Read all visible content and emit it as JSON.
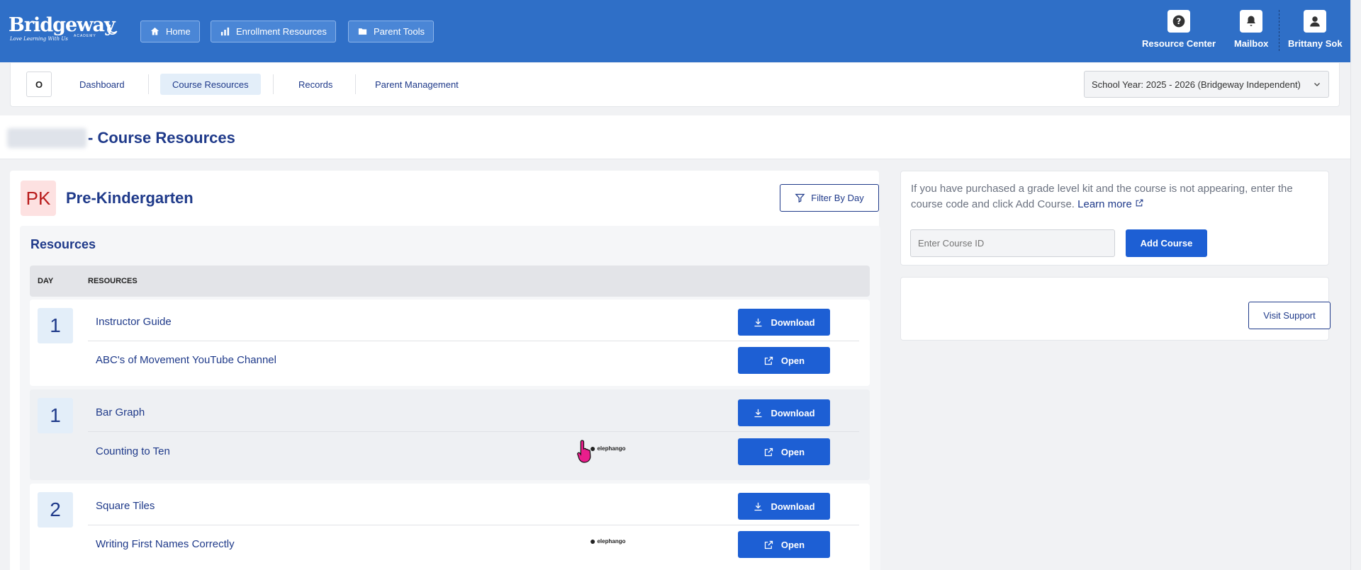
{
  "header": {
    "logo_text": "Bridgeway",
    "logo_sub": "Love Learning With Us",
    "logo_academy": "ACADEMY",
    "nav": [
      {
        "label": "Home",
        "icon": "home-icon"
      },
      {
        "label": "Enrollment Resources",
        "icon": "bar-chart-icon"
      },
      {
        "label": "Parent Tools",
        "icon": "folder-icon"
      }
    ],
    "resource_center": "Resource Center",
    "mailbox": "Mailbox",
    "user_name": "Brittany Sok"
  },
  "subnav": {
    "o_button": "O",
    "tabs": [
      "Dashboard",
      "Course Resources",
      "Records",
      "Parent Management"
    ],
    "active_tab": "Course Resources",
    "school_year": "School Year: 2025 - 2026 (Bridgeway Independent)"
  },
  "page": {
    "title": "- Course Resources"
  },
  "grade": {
    "badge": "PK",
    "name": "Pre-Kindergarten",
    "filter_label": "Filter By Day"
  },
  "resources": {
    "heading": "Resources",
    "col_day": "DAY",
    "col_resources": "RESOURCES",
    "groups": [
      {
        "day": "1",
        "items": [
          {
            "name": "Instructor Guide",
            "action": "Download"
          },
          {
            "name": "ABC's of Movement YouTube Channel",
            "action": "Open"
          }
        ]
      },
      {
        "day": "1",
        "items": [
          {
            "name": "Bar Graph",
            "action": "Download"
          },
          {
            "name": "Counting to Ten",
            "action": "Open",
            "partner": "elephango"
          }
        ]
      },
      {
        "day": "2",
        "items": [
          {
            "name": "Square Tiles",
            "action": "Download"
          },
          {
            "name": "Writing First Names Correctly",
            "action": "Open",
            "partner": "elephango"
          }
        ]
      }
    ]
  },
  "add_course": {
    "info": "If you have purchased a grade level kit and the course is not appearing, enter the course code and click Add Course.",
    "learn_more": "Learn more",
    "placeholder": "Enter Course ID",
    "button": "Add Course"
  },
  "support": {
    "button": "Visit Support"
  },
  "colors": {
    "header_bg": "#2f6fc7",
    "primary_button": "#1d5fd4",
    "text_navy": "#1f3a8a",
    "pk_badge_bg": "#fde1e1",
    "pk_badge_text": "#b91c1c"
  }
}
